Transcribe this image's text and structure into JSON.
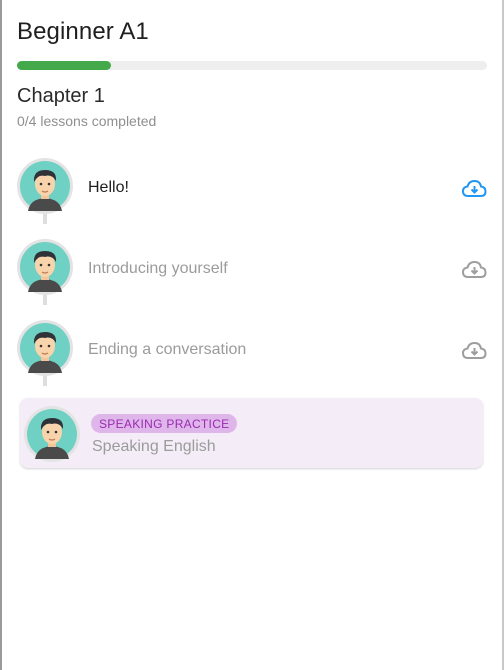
{
  "header": {
    "title": "Beginner A1",
    "progress_fraction": 0.2,
    "progress_color": "#43a94a"
  },
  "chapter": {
    "title": "Chapter 1",
    "subtitle": "0/4 lessons completed"
  },
  "lessons": [
    {
      "label": "Hello!",
      "state": "available",
      "icon": "cloud-download-icon",
      "icon_color": "#2196f3"
    },
    {
      "label": "Introducing yourself",
      "state": "locked",
      "icon": "cloud-download-icon",
      "icon_color": "#9e9e9e"
    },
    {
      "label": "Ending a conversation",
      "state": "locked",
      "icon": "cloud-download-icon",
      "icon_color": "#9e9e9e"
    }
  ],
  "practice": {
    "badge": "SPEAKING PRACTICE",
    "label": "Speaking English",
    "badge_color": "#9b2ab2"
  }
}
